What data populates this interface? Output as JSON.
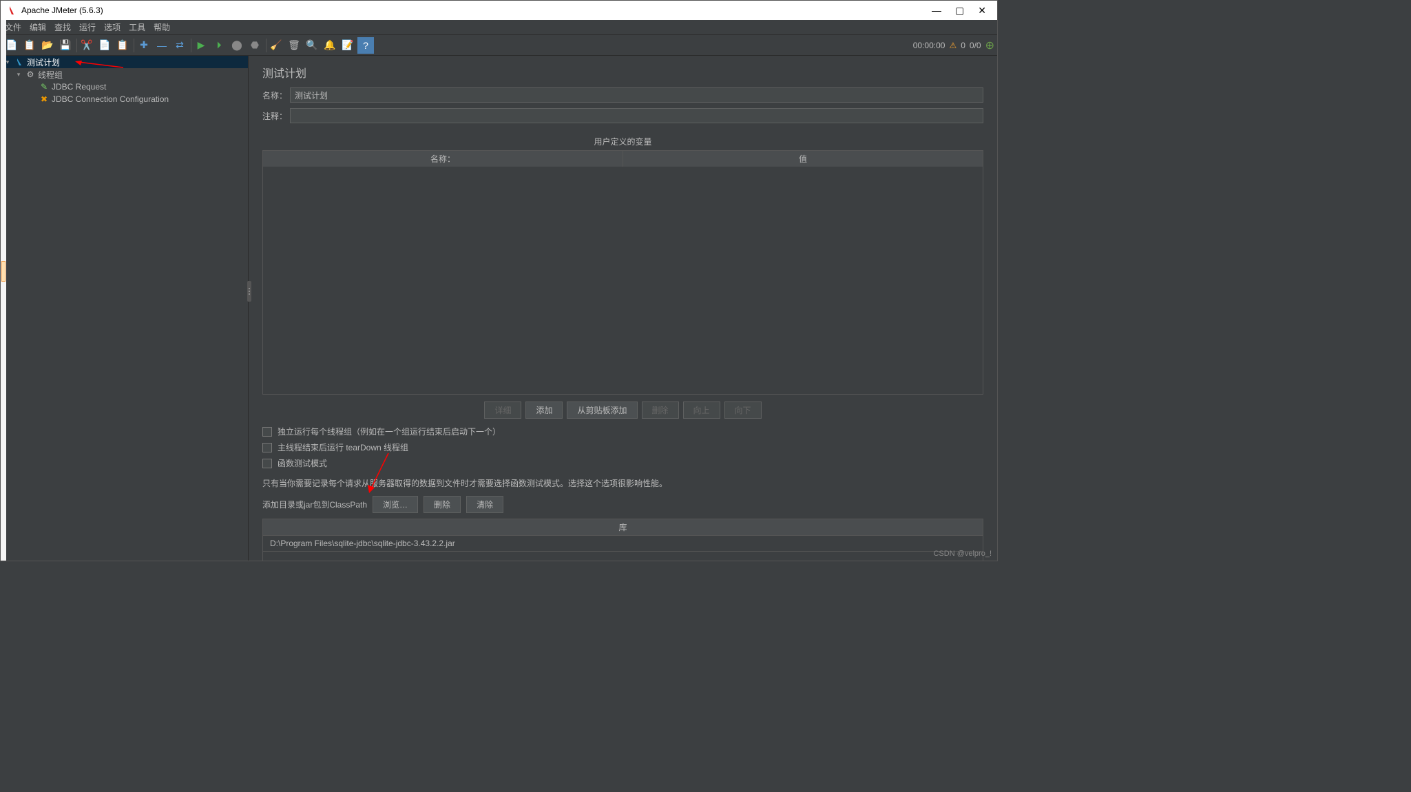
{
  "titlebar": {
    "title": "Apache JMeter (5.6.3)"
  },
  "menubar": {
    "items": [
      "文件",
      "编辑",
      "查找",
      "运行",
      "选项",
      "工具",
      "帮助"
    ]
  },
  "toolbar": {
    "status_time": "00:00:00",
    "status_count1": "0",
    "status_count2": "0/0"
  },
  "tree": {
    "items": [
      {
        "label": "测试计划",
        "indent": 0,
        "icon": "jmeter-icon",
        "selected": true,
        "expanded": true
      },
      {
        "label": "线程组",
        "indent": 1,
        "icon": "gear-icon",
        "selected": false,
        "expanded": true
      },
      {
        "label": "JDBC Request",
        "indent": 2,
        "icon": "request-icon",
        "selected": false,
        "expanded": null
      },
      {
        "label": "JDBC Connection Configuration",
        "indent": 2,
        "icon": "wrench-icon",
        "selected": false,
        "expanded": null
      }
    ]
  },
  "main": {
    "title": "测试计划",
    "name_label": "名称：",
    "name_value": "测试计划",
    "comment_label": "注释：",
    "comment_value": "",
    "vars_section": "用户定义的变量",
    "vars_col1": "名称：",
    "vars_col2": "值",
    "btn_detail": "详细",
    "btn_add": "添加",
    "btn_clipboard": "从剪贴板添加",
    "btn_delete": "删除",
    "btn_up": "向上",
    "btn_down": "向下",
    "cb1": "独立运行每个线程组（例如在一个组运行结束后启动下一个）",
    "cb2": "主线程结束后运行 tearDown 线程组",
    "cb3": "函数测试模式",
    "hint": "只有当你需要记录每个请求从服务器取得的数据到文件时才需要选择函数测试模式。选择这个选项很影响性能。",
    "classpath_label": "添加目录或jar包到ClassPath",
    "btn_browse": "浏览…",
    "btn_del2": "删除",
    "btn_clear": "清除",
    "lib_header": "库",
    "lib_row0": "D:\\Program Files\\sqlite-jdbc\\sqlite-jdbc-3.43.2.2.jar"
  },
  "watermark": "CSDN @velpro_!"
}
